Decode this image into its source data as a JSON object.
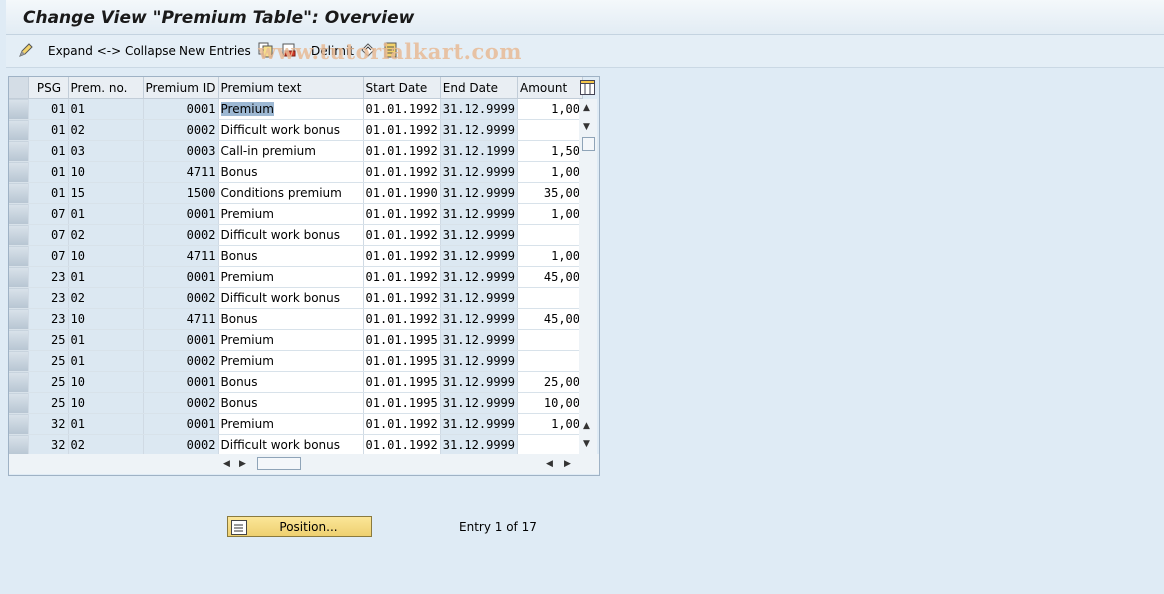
{
  "title": "Change View \"Premium Table\": Overview",
  "toolbar": {
    "expand_collapse": "Expand <-> Collapse",
    "new_entries": "New Entries",
    "delimit": "Delimit"
  },
  "watermark": "www.tutorialkart.com",
  "columns": [
    "PSG",
    "Prem. no.",
    "Premium ID",
    "Premium text",
    "Start Date",
    "End Date",
    "Amount"
  ],
  "rows": [
    {
      "psg": "01",
      "prem_no": "01",
      "premium_id": "0001",
      "text": "Premium",
      "start": "01.01.1992",
      "end": "31.12.9999",
      "amount": "1,00"
    },
    {
      "psg": "01",
      "prem_no": "02",
      "premium_id": "0002",
      "text": "Difficult work bonus",
      "start": "01.01.1992",
      "end": "31.12.9999",
      "amount": ""
    },
    {
      "psg": "01",
      "prem_no": "03",
      "premium_id": "0003",
      "text": "Call-in premium",
      "start": "01.01.1992",
      "end": "31.12.1999",
      "amount": "1,50"
    },
    {
      "psg": "01",
      "prem_no": "10",
      "premium_id": "4711",
      "text": "Bonus",
      "start": "01.01.1992",
      "end": "31.12.9999",
      "amount": "1,00"
    },
    {
      "psg": "01",
      "prem_no": "15",
      "premium_id": "1500",
      "text": "Conditions premium",
      "start": "01.01.1990",
      "end": "31.12.9999",
      "amount": "35,00"
    },
    {
      "psg": "07",
      "prem_no": "01",
      "premium_id": "0001",
      "text": "Premium",
      "start": "01.01.1992",
      "end": "31.12.9999",
      "amount": "1,00"
    },
    {
      "psg": "07",
      "prem_no": "02",
      "premium_id": "0002",
      "text": "Difficult work bonus",
      "start": "01.01.1992",
      "end": "31.12.9999",
      "amount": ""
    },
    {
      "psg": "07",
      "prem_no": "10",
      "premium_id": "4711",
      "text": "Bonus",
      "start": "01.01.1992",
      "end": "31.12.9999",
      "amount": "1,00"
    },
    {
      "psg": "23",
      "prem_no": "01",
      "premium_id": "0001",
      "text": "Premium",
      "start": "01.01.1992",
      "end": "31.12.9999",
      "amount": "45,00"
    },
    {
      "psg": "23",
      "prem_no": "02",
      "premium_id": "0002",
      "text": "Difficult work bonus",
      "start": "01.01.1992",
      "end": "31.12.9999",
      "amount": ""
    },
    {
      "psg": "23",
      "prem_no": "10",
      "premium_id": "4711",
      "text": "Bonus",
      "start": "01.01.1992",
      "end": "31.12.9999",
      "amount": "45,00"
    },
    {
      "psg": "25",
      "prem_no": "01",
      "premium_id": "0001",
      "text": "Premium",
      "start": "01.01.1995",
      "end": "31.12.9999",
      "amount": ""
    },
    {
      "psg": "25",
      "prem_no": "01",
      "premium_id": "0002",
      "text": "Premium",
      "start": "01.01.1995",
      "end": "31.12.9999",
      "amount": ""
    },
    {
      "psg": "25",
      "prem_no": "10",
      "premium_id": "0001",
      "text": "Bonus",
      "start": "01.01.1995",
      "end": "31.12.9999",
      "amount": "25,00"
    },
    {
      "psg": "25",
      "prem_no": "10",
      "premium_id": "0002",
      "text": "Bonus",
      "start": "01.01.1995",
      "end": "31.12.9999",
      "amount": "10,00"
    },
    {
      "psg": "32",
      "prem_no": "01",
      "premium_id": "0001",
      "text": "Premium",
      "start": "01.01.1992",
      "end": "31.12.9999",
      "amount": "1,00"
    },
    {
      "psg": "32",
      "prem_no": "02",
      "premium_id": "0002",
      "text": "Difficult work bonus",
      "start": "01.01.1992",
      "end": "31.12.9999",
      "amount": ""
    }
  ],
  "position_button": "Position...",
  "entry_info": "Entry 1 of 17"
}
